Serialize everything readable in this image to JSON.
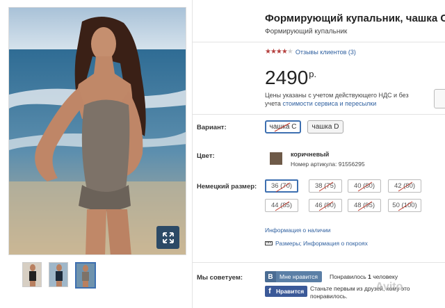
{
  "product": {
    "title": "Формирующий купальник, чашка С",
    "subtitle": "Формирующий купальник",
    "rating_stars": 4,
    "reviews_link": "Отзывы клиентов (3)",
    "price": "2490",
    "currency": "р.",
    "price_note_prefix": "Цены указаны с учетом действующего НДС и без учета",
    "price_note_link": "стоимости сервиса и пересылки"
  },
  "variant": {
    "label": "Вариант:",
    "options": [
      "чашка C",
      "чашка D"
    ],
    "selected": "чашка C"
  },
  "color": {
    "label": "Цвет:",
    "name": "коричневый",
    "article": "Номер артикула: 91556295",
    "swatch": "#6e5a48"
  },
  "size": {
    "label": "Немецкий размер:",
    "options": [
      "36 (70)",
      "38 (75)",
      "40 (80)",
      "42 (80)",
      "44 (85)",
      "46 (90)",
      "48 (95)",
      "50 (100)"
    ],
    "selected": "36 (70)"
  },
  "links": {
    "availability": "Информация о наличии",
    "sizes": "Размеры; Информация о покроях"
  },
  "social": {
    "label": "Мы советуем:",
    "vk_button": "Мне нравится",
    "vk_logo": "В",
    "vk_text_prefix": "Понравилось",
    "vk_count": "1",
    "vk_text_suffix": "человеку",
    "fb_logo": "f",
    "fb_button": "Нравится",
    "fb_text": "Станьте первым из друзей, кому это понравилось."
  },
  "watermark": "Avito",
  "colors": {
    "link": "#2e5f9f",
    "selected_border": "#3d6fb0",
    "strike": "#c0392b",
    "star": "#b5413f"
  }
}
